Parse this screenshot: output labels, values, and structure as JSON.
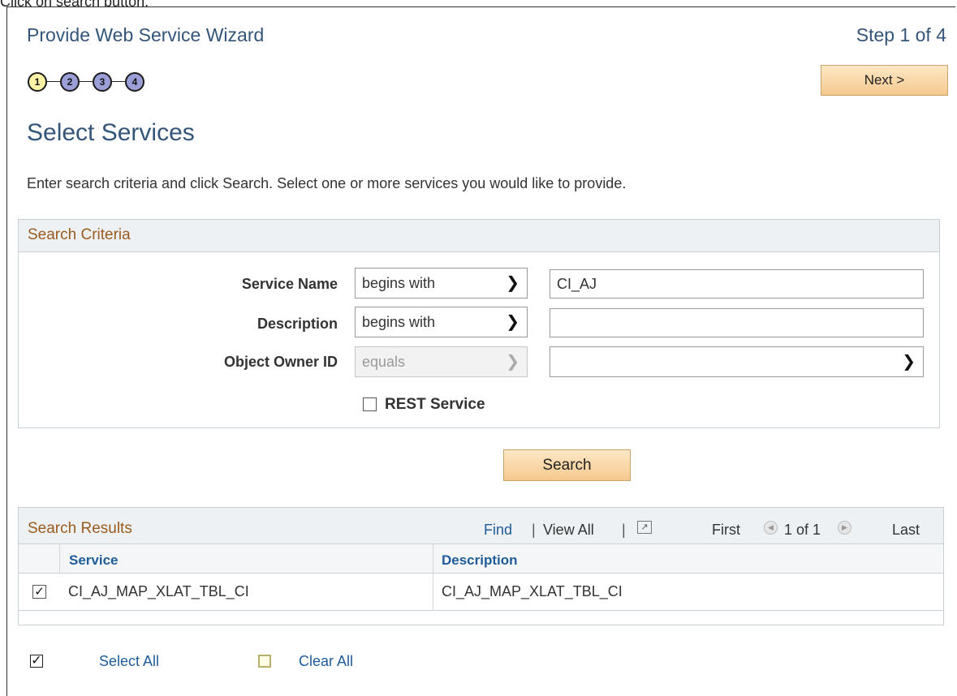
{
  "instruction": "Click on search button.",
  "wizard": {
    "title": "Provide Web Service Wizard",
    "step_label": "Step 1 of 4",
    "steps": [
      "1",
      "2",
      "3",
      "4"
    ],
    "current_step": 1,
    "next_label": "Next >"
  },
  "page": {
    "title": "Select Services",
    "help_text": "Enter search criteria and click Search. Select one or more services you would like to provide."
  },
  "search_criteria": {
    "header": "Search Criteria",
    "service_name": {
      "label": "Service Name",
      "operator": "begins with",
      "value": "CI_AJ"
    },
    "description": {
      "label": "Description",
      "operator": "begins with",
      "value": ""
    },
    "object_owner": {
      "label": "Object Owner ID",
      "operator": "equals",
      "value": ""
    },
    "rest_service": {
      "label": "REST Service",
      "checked": false
    },
    "search_label": "Search"
  },
  "results": {
    "title": "Search Results",
    "find": "Find",
    "view_all": "View All",
    "first": "First",
    "range": "1 of 1",
    "last": "Last",
    "columns": [
      "Service",
      "Description"
    ],
    "rows": [
      {
        "checked": true,
        "service": "CI_AJ_MAP_XLAT_TBL_CI",
        "description": "CI_AJ_MAP_XLAT_TBL_CI"
      }
    ]
  },
  "footer": {
    "select_all": "Select All",
    "clear_all": "Clear All"
  },
  "colors": {
    "accent_title": "#34557a",
    "section_header": "#9a5b1f",
    "link": "#1f5c99",
    "button_gradient_top": "#fde7c5",
    "button_gradient_bottom": "#f5c98e",
    "current_step": "#fff3a8",
    "pending_step": "#9c9ed8"
  }
}
